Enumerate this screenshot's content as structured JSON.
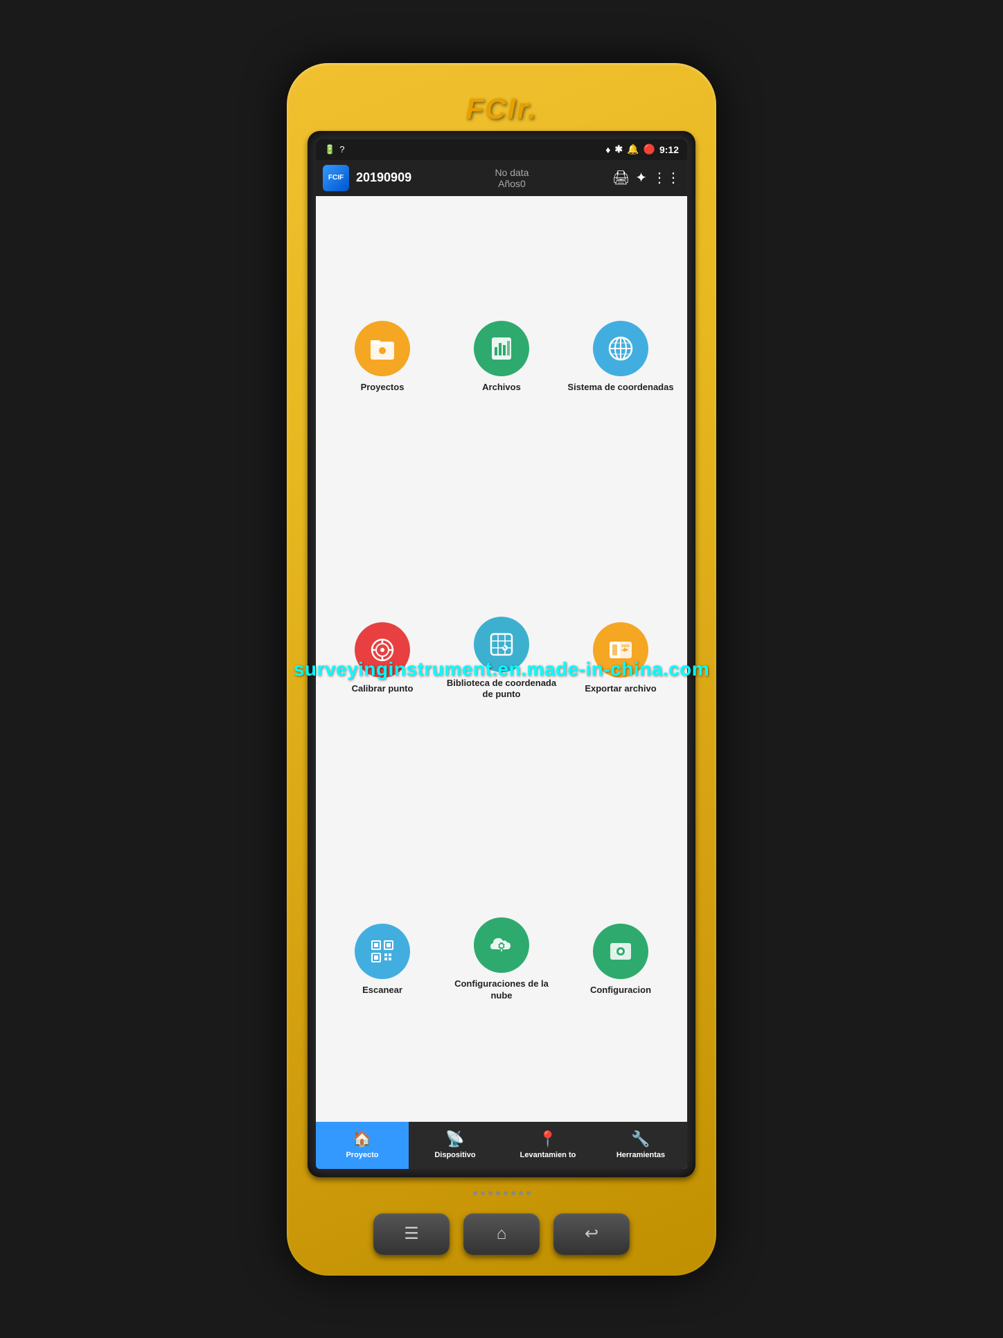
{
  "device": {
    "brand": "FCIr.",
    "watermark": "surveyinginstrument.en.made-in-china.com"
  },
  "statusBar": {
    "battery_icon": "🔋",
    "question_mark": "?",
    "location_icon": "📍",
    "bluetooth_icon": "✱",
    "sound_icon": "🔔",
    "time": "9:12"
  },
  "header": {
    "logo_text": "FCIF",
    "project_date": "20190909",
    "no_data_label": "No data",
    "years_label": "Años0"
  },
  "apps": [
    {
      "id": "proyectos",
      "label": "Proyectos",
      "color_class": "icon-orange",
      "icon": "folder"
    },
    {
      "id": "archivos",
      "label": "Archivos",
      "color_class": "icon-green-dark",
      "icon": "chart"
    },
    {
      "id": "sistema-coordenadas",
      "label": "Sistema de coordenadas",
      "color_class": "icon-blue",
      "icon": "globe"
    },
    {
      "id": "calibrar-punto",
      "label": "Calibrar punto",
      "color_class": "icon-red",
      "icon": "target"
    },
    {
      "id": "biblioteca",
      "label": "Biblioteca de coordenada de punto",
      "color_class": "icon-blue-mid",
      "icon": "map"
    },
    {
      "id": "exportar",
      "label": "Exportar archivo",
      "color_class": "icon-orange2",
      "icon": "export"
    },
    {
      "id": "escanear",
      "label": "Escanear",
      "color_class": "icon-blue2",
      "icon": "qr"
    },
    {
      "id": "config-nube",
      "label": "Configuraciones de la nube",
      "color_class": "icon-teal",
      "icon": "cloud"
    },
    {
      "id": "configuracion",
      "label": "Configuracion",
      "color_class": "icon-teal2",
      "icon": "settings"
    }
  ],
  "bottomNav": [
    {
      "id": "proyecto",
      "label": "Proyecto",
      "icon": "🏠",
      "active": true
    },
    {
      "id": "dispositivo",
      "label": "Dispositivo",
      "icon": "📡",
      "active": false
    },
    {
      "id": "levantamiento",
      "label": "Levantamien to",
      "icon": "📍",
      "active": false
    },
    {
      "id": "herramientas",
      "label": "Herramientas",
      "icon": "🔧",
      "active": false
    }
  ],
  "hwButtons": [
    {
      "id": "menu-btn",
      "icon": "☰"
    },
    {
      "id": "home-btn",
      "icon": "⌂"
    },
    {
      "id": "back-btn",
      "icon": "↩"
    }
  ]
}
